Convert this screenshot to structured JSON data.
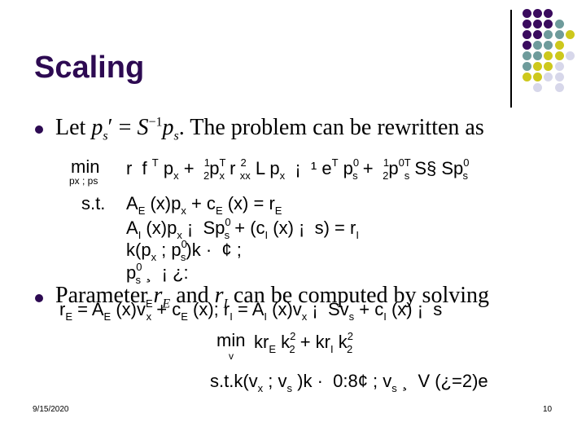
{
  "slide": {
    "title": "Scaling",
    "bullets": [
      {
        "parts": {
          "lead": "Let ",
          "ps_prime": "p",
          "ps_prime_sub": "s",
          "prime": "′ = ",
          "S": "S",
          "S_sup": "−1",
          "ps": "p",
          "ps_sub": "s",
          "tail": ". The problem can be rewritten as"
        }
      },
      {
        "parts": {
          "lead": "Parameter ",
          "rE": "r",
          "rE_sub": "E",
          "and": " and ",
          "rI": "r",
          "rI_sub": "I",
          "tail": " can be computed by solving"
        }
      }
    ],
    "equations": {
      "min_label": "min",
      "min_sub": "px ; ps",
      "objective_line": [
        "r  f ",
        "T",
        " p",
        "x",
        " +  ",
        "1",
        "2",
        "p",
        "T",
        "x",
        " r ",
        "2",
        "xx",
        " L p",
        "x",
        "  ¡  ",
        "¹ e",
        "T",
        " p",
        "0",
        "s",
        " +  ",
        "1",
        "2",
        "p",
        "0T",
        "s",
        " S§ Sp",
        "0",
        "s"
      ],
      "st_label": "s.t.",
      "constraint_1": [
        "A",
        "E",
        " (x)p",
        "x",
        " + c",
        "E",
        " (x) = r",
        "E"
      ],
      "constraint_2": [
        "A",
        "I",
        " (x)p",
        "x",
        " ¡  Sp",
        "0",
        "s",
        " + (c",
        "I",
        " (x) ¡  s) = r",
        "I"
      ],
      "constraint_3": [
        "k(p",
        "x",
        " ; p",
        "0",
        "s",
        ")k ·  ¢ ;"
      ],
      "constraint_4": [
        "p",
        "0",
        "s",
        " ¸  ¡ ¿:"
      ]
    },
    "overlay_line": [
      "r",
      "E",
      " = A",
      "E",
      " (x)v",
      "E",
      "x",
      " + c",
      "E",
      " (x); r",
      "I",
      " = A",
      "I",
      " (x)v",
      "x",
      " ¡  Sv",
      "s",
      " + c",
      "I",
      " (x) ¡  s"
    ],
    "second_problem": {
      "min_label": "min",
      "min_sub": "v",
      "objective": [
        "kr",
        "E",
        " k",
        "2",
        "2",
        " + kr",
        "I",
        " k",
        "2",
        "2"
      ],
      "constraint": [
        "s.t.k(v",
        "x",
        " ; v",
        "s",
        " )k ·  0:8¢ ; v",
        "s",
        " ¸  V (¿=2)e"
      ]
    },
    "footer": {
      "date": "9/15/2020",
      "page": "10"
    }
  },
  "colors": {
    "title": "#2d0a52",
    "bullet": "#2d0a52",
    "dot_purple": "#3a0b5e",
    "dot_teal": "#6e9b9b",
    "dot_yellow": "#cdc81c",
    "dot_lavender": "#d7d7ea"
  },
  "decoration": {
    "dot_grid": [
      [
        "P",
        "P",
        "P",
        "",
        ""
      ],
      [
        "P",
        "P",
        "P",
        "T",
        ""
      ],
      [
        "P",
        "P",
        "T",
        "T",
        "Y"
      ],
      [
        "P",
        "T",
        "T",
        "Y",
        ""
      ],
      [
        "T",
        "T",
        "Y",
        "Y",
        "L"
      ],
      [
        "T",
        "Y",
        "Y",
        "L",
        ""
      ],
      [
        "Y",
        "Y",
        "L",
        "L",
        ""
      ],
      [
        "",
        "L",
        "",
        "L",
        ""
      ]
    ]
  }
}
